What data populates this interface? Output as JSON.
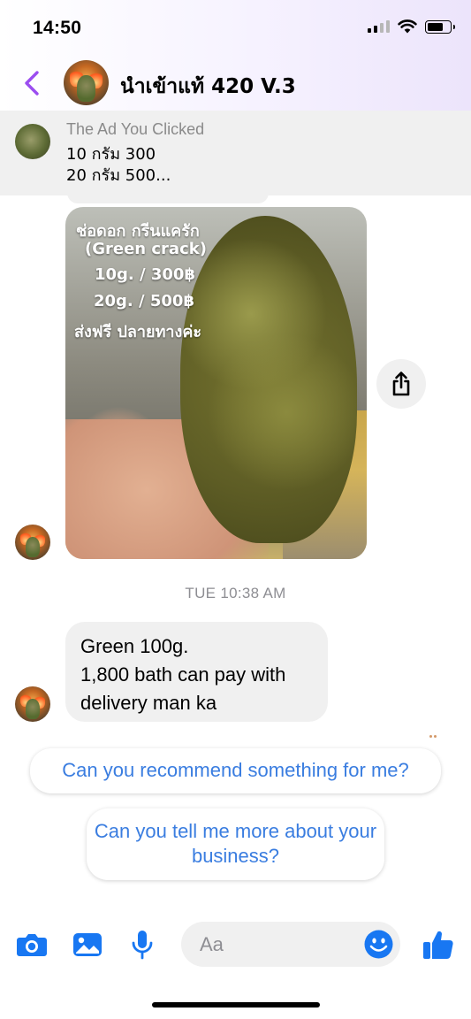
{
  "status_bar": {
    "time": "14:50"
  },
  "header": {
    "title": "นำเข้าแท้ 420 V.3",
    "back_icon": "chevron-left-icon",
    "accent_color": "#9b4df0"
  },
  "ad": {
    "label": "The Ad You Clicked",
    "line1": "10 กรัม 300",
    "line2": "20 กรัม 500..."
  },
  "image_message": {
    "overlay_lines": [
      "ช่อดอก กรีนแครัก",
      "(Green crack)",
      "10g. / 300฿",
      "20g. / 500฿",
      "ส่งฟรี ปลายทางค่ะ"
    ],
    "share_icon": "share-icon"
  },
  "conversation": {
    "timestamp": "TUE 10:38 AM",
    "message_lines": [
      "Green 100g.",
      "1,800 bath can pay with",
      "delivery man ka"
    ]
  },
  "suggestions": [
    "Can you recommend something for me?",
    "Can you tell me more about your business?"
  ],
  "composer": {
    "placeholder": "Aa",
    "icons": [
      "camera-icon",
      "photo-icon",
      "microphone-icon",
      "emoji-icon",
      "thumbs-up-icon"
    ],
    "icon_color": "#1877f2"
  }
}
